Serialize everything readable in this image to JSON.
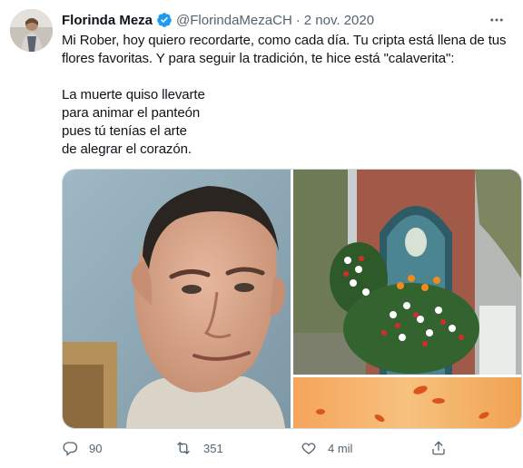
{
  "tweet": {
    "author_name": "Florinda Meza",
    "handle": "@FlorindaMezaCH",
    "separator": "·",
    "date": "2 nov. 2020",
    "verified": true,
    "text": {
      "line1": "Mi Rober, hoy quiero recordarte, como cada día. Tu cripta está llena de tus",
      "line2": "flores favoritas. Y para seguir la tradición, te hice está \"calaverita\":",
      "poem1": "La muerte quiso llevarte",
      "poem2": "para animar el panteón",
      "poem3": "pues tú tenías el arte",
      "poem4": "de alegrar el corazón."
    },
    "media_count": 3
  },
  "actions": {
    "reply_count": "90",
    "retweet_count": "351",
    "like_count": "4 mil"
  },
  "colors": {
    "text": "#0f1419",
    "secondary": "#536471",
    "verified_badge": "#1d9bf0",
    "border": "#cfd9de"
  },
  "icons": [
    "verified-badge-icon",
    "more-icon",
    "reply-icon",
    "retweet-icon",
    "like-icon",
    "share-icon"
  ]
}
